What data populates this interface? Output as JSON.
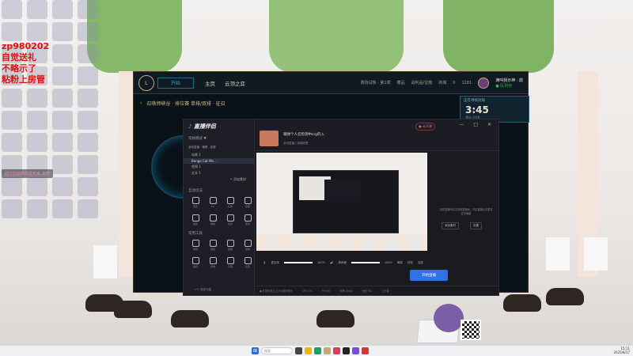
{
  "overlay": {
    "line1": "zp980202",
    "line2": "自觉送礼",
    "line3": "不略示了",
    "line4": "粘粉上房管",
    "danmaku": "财万犯给你的发布来 来吧"
  },
  "lol_client": {
    "play_label": "开始",
    "nav": [
      "主页",
      "云顶之弈"
    ],
    "top_right": {
      "blue_essence": "0",
      "rp": "1281",
      "player_name": "满叫我示神 · 鼎",
      "status": "● 队列中"
    },
    "header_icons": [
      "赛场试炼 · 第1章",
      "藏品",
      "战利品/宝箱",
      "商城"
    ],
    "mode_title": "召唤师峡谷 · 排位赛 单排/双排 · 征召",
    "queue": {
      "title": "正在寻找对局",
      "time": "3:45",
      "subtitle": "预计 3:00"
    }
  },
  "streamer_app": {
    "logo_text": "直播伴侣",
    "scene_section": "常规模式 ▼",
    "scene_tabs": "游戏直播 · 横屏 · 竖屏",
    "scenes": [
      "场景 1",
      "Bongo Cat Mv...",
      "视频 1",
      "文本 1"
    ],
    "add_scene": "+ 添加素材",
    "interact_section": "互动玩法",
    "interact_tools": [
      "连麦",
      "PK",
      "礼物",
      "投票",
      "抽奖",
      "福袋",
      "任务",
      "更多"
    ],
    "common_section": "常用工具",
    "common_tools": [
      "弹幕",
      "美颜",
      "截图",
      "录制",
      "贴纸",
      "音效",
      "字幕",
      "设置"
    ],
    "more_funcs": "••• 更多功能",
    "room_title": "钢弹个人云检测中ing的入",
    "room_tags": "游戏直播 | 英雄联盟",
    "start_stream_label": "● 未开播",
    "window_controls": "— □ ✕",
    "right_msg": "请在直播伴侣中设置直播间，开启直播后这里将显示弹幕",
    "right_btn1": "添加素材",
    "right_btn2": "设置",
    "mixer": {
      "mic_label": "麦克风",
      "mic_value": "100%",
      "desk_label": "扬声器",
      "desk_value": "100%",
      "tools": [
        "美颜",
        "特效",
        "连麦"
      ]
    },
    "go_live": "开始直播",
    "status_bar": [
      "● 在场景显示上方出现的提示",
      "CPU 2%",
      "FPS 60",
      "码率 0kb/s",
      "丢帧 0%",
      "上行量"
    ]
  },
  "taskbar": {
    "search_placeholder": "搜索",
    "time": "15:11",
    "date": "2025/8/17"
  }
}
